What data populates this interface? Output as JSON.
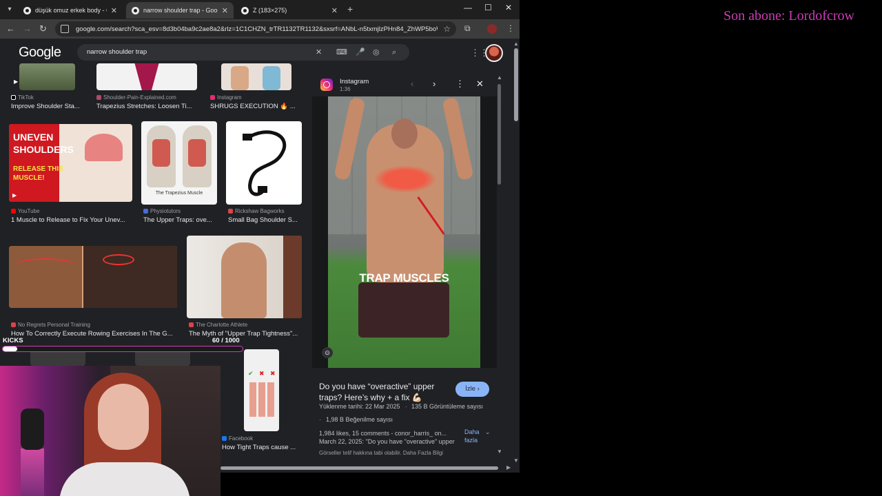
{
  "browser": {
    "tabs": [
      {
        "title": "düşük omuz erkek body - Goog",
        "active": false
      },
      {
        "title": "narrow shoulder trap - Google",
        "active": true
      },
      {
        "title": "Z (183×275)",
        "active": false
      }
    ],
    "url": "google.com/search?sca_esv=8d3b04ba9c2ae8a2&rlz=1C1CHZN_trTR1132TR1132&sxsrf=ANbL-n5txmjlzPHn84_ZhWP5boW-t..."
  },
  "google": {
    "logo": "Google",
    "query": "narrow shoulder trap"
  },
  "results": [
    {
      "source": "TikTok",
      "caption": "Improve Shoulder Sta...",
      "source_color": "#000000"
    },
    {
      "source": "Shoulder-Pain-Explained.com",
      "caption": "Trapezius Stretches: Loosen Ti...",
      "source_color": "#b04a6a"
    },
    {
      "source": "Instagram",
      "caption": "SHRUGS EXECUTION 🔥 ...",
      "source_color": "#e1306c"
    },
    {
      "source": "YouTube",
      "caption": "1 Muscle to Release to Fix Your Unev...",
      "source_color": "#ff0000"
    },
    {
      "source": "Physiotutors",
      "caption": "The Upper Traps: ove...",
      "source_color": "#4a6ad8"
    },
    {
      "source": "Rickshaw Bagworks",
      "caption": "Small Bag Shoulder S...",
      "source_color": "#d8444a"
    },
    {
      "source": "No Regrets Personal Training",
      "caption": "How To Correctly Execute Rowing Exercises In The G...",
      "source_color": "#d8444a"
    },
    {
      "source": "The Charlotte Athlete",
      "caption": "The Myth of \"Upper Trap Tightness\"...",
      "source_color": "#d8444a"
    },
    {
      "source": "Facebook",
      "caption": "How Tight Traps cause ...",
      "source_color": "#1877f2"
    }
  ],
  "thumbnails": {
    "uneven_line1": "UNEVEN",
    "uneven_line2": "SHOULDERS",
    "uneven_line3": "RELEASE THIS",
    "uneven_line4": "MUSCLE!",
    "trapezius_label": "The Trapezius Muscle"
  },
  "panel": {
    "source": "Instagram",
    "duration": "1:36",
    "video_text": "TRAP MUSCLES",
    "title": "Do you have “overactive” upper traps? Here’s why + a fix 💪🏻",
    "watch_label": "İzle ›",
    "upload_date": "Yüklenme tarihi: 22 Mar 2025",
    "views": "135 B Görüntüleme sayısı",
    "likes": "1,98 B Beğenilme sayısı",
    "description": "1,984 likes, 15 comments - conor_harris_ on... March 22, 2025: \"Do you have \"overactive\" upper",
    "more_label": "Daha fazla",
    "legal": "Görseller telif hakkına tabi olabilir. Daha Fazla Bilgi"
  },
  "overlay": {
    "last_sub": "Son abone: Lordofcrow",
    "kicks_label": "KICKS",
    "kicks_count": "60  / 1000",
    "kicks_progress": 0.06,
    "accent": "#cc3cb6"
  }
}
